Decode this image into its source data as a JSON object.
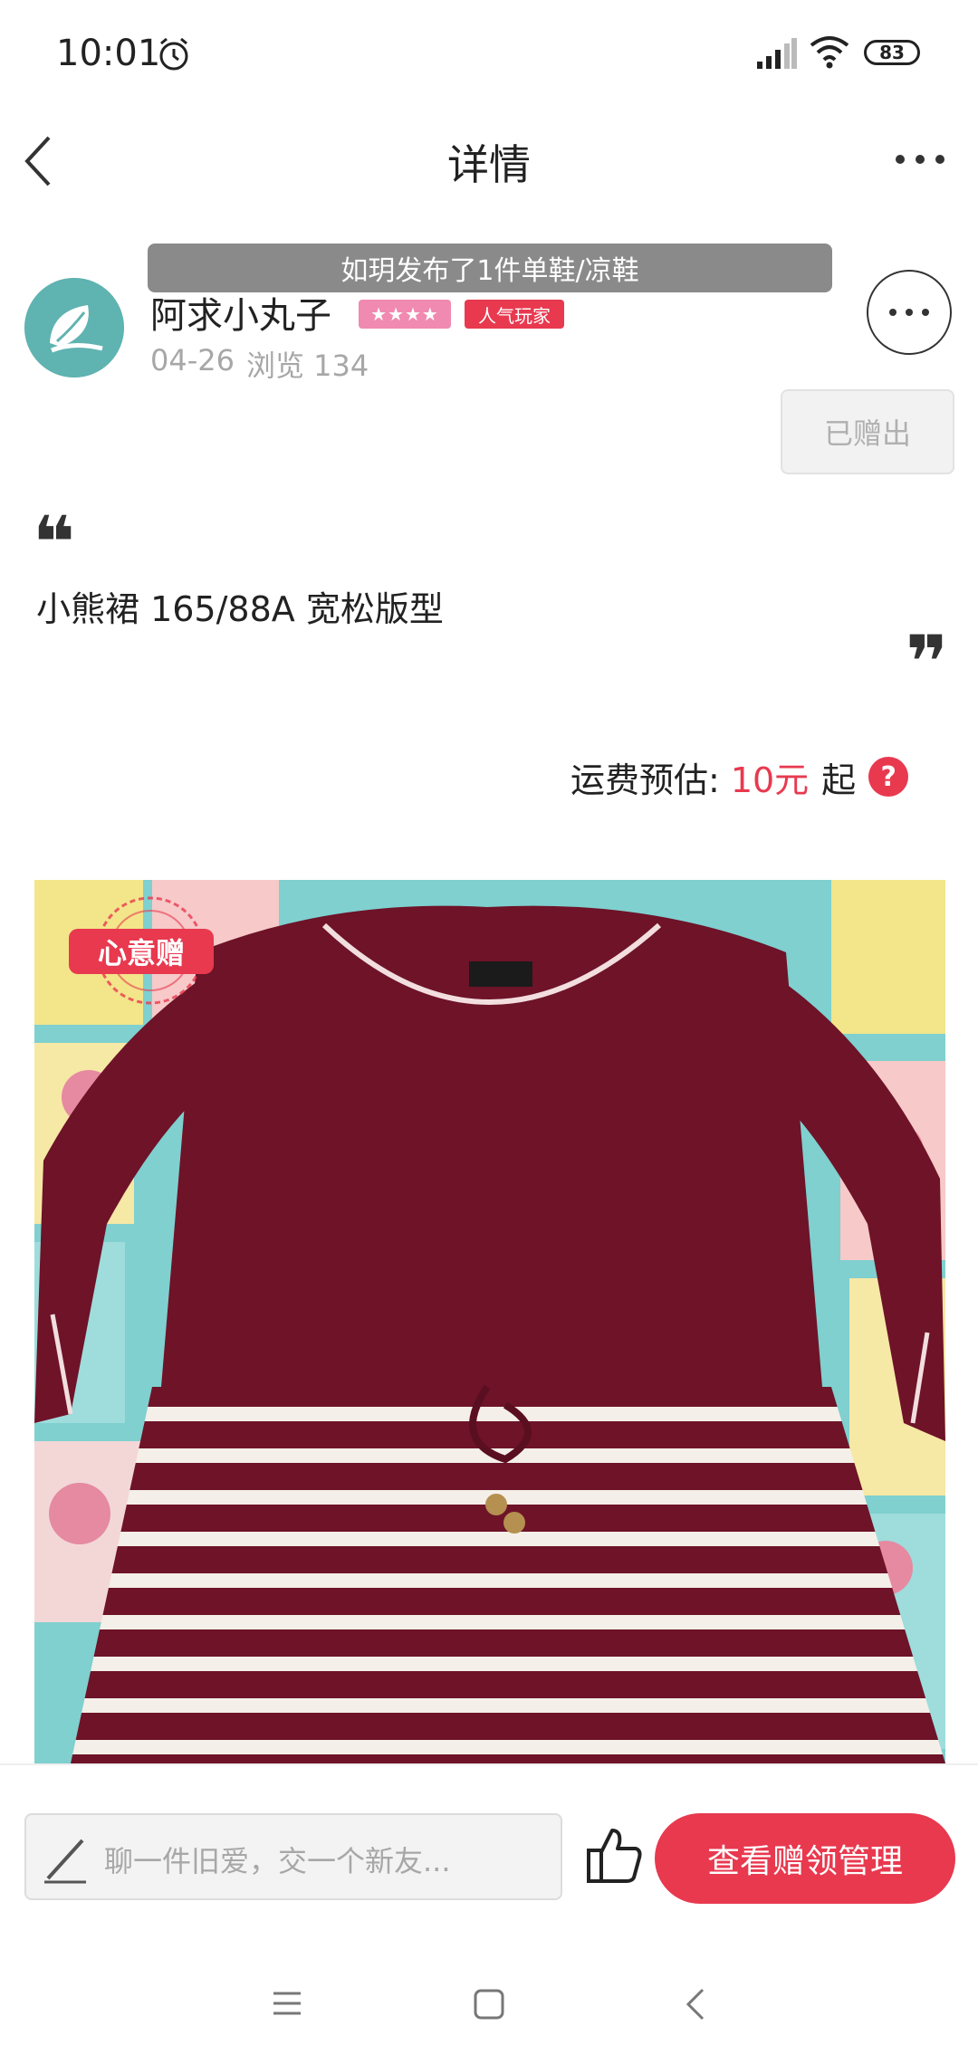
{
  "status_bar": {
    "time": "10:01",
    "battery": "83",
    "icons": [
      "alarm-icon",
      "signal-icon",
      "wifi-icon",
      "battery-icon"
    ]
  },
  "nav": {
    "title": "详情",
    "back_icon": "chevron-left-icon",
    "more_icon": "more-horizontal-icon"
  },
  "notice": {
    "text": "如玥发布了1件单鞋/凉鞋"
  },
  "user": {
    "name": "阿求小丸子",
    "stars_badge": "★★★★",
    "popular_badge": "人气玩家",
    "date": "04-26",
    "views": "浏览 134",
    "given_button": "已赠出"
  },
  "post": {
    "quote_open": "❝",
    "text": "小熊裙 165/88A 宽松版型",
    "quote_close": "❞"
  },
  "shipping": {
    "label": "运费预估:",
    "price": "10元",
    "suffix": "起",
    "help": "?"
  },
  "photo": {
    "badge": "心意赠"
  },
  "bottom_bar": {
    "placeholder": "聊一件旧爱，交一个新友...",
    "manage_button": "查看赠领管理"
  },
  "colors": {
    "accent": "#e8394f",
    "banner": "#8a8a8a",
    "muted_text": "#a7a7a7",
    "dress": "#6e1328",
    "avatar": "#5fb3b0"
  }
}
